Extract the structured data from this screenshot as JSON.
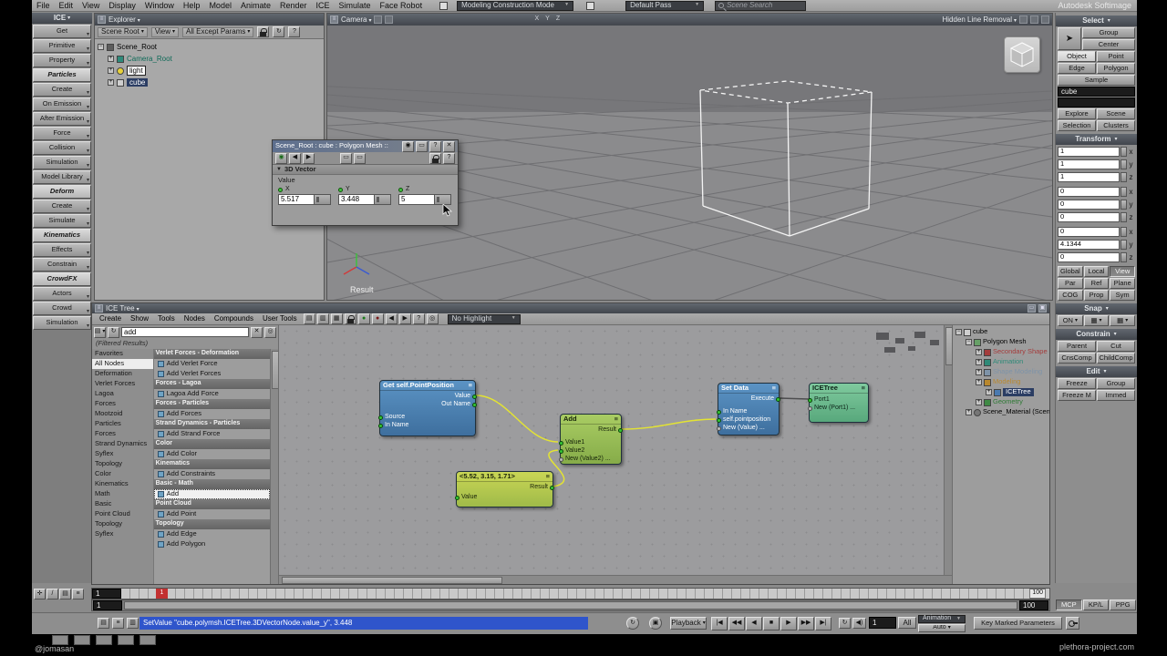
{
  "app": {
    "title": "Autodesk Softimage"
  },
  "footer": {
    "left": "@jomasan",
    "right": "plethora-project.com"
  },
  "icons": {
    "menu": "≡",
    "dropdown": "▾",
    "close": "✕",
    "help": "?",
    "refresh": "↻",
    "left": "◀",
    "right": "▶",
    "grid": "▦",
    "box": "▭",
    "circle": "◉",
    "record": "●",
    "loop": "↻",
    "speaker": "◀)",
    "plus": "+",
    "minus": "−",
    "target": "◎",
    "pan": "✛",
    "pencil": "/",
    "list": "▤",
    "rows": "▥"
  },
  "menubar": {
    "menus": [
      "File",
      "Edit",
      "View",
      "Display",
      "Window",
      "Help",
      "Model",
      "Animate",
      "Render",
      "ICE",
      "Simulate",
      "Face Robot"
    ],
    "construction_mode": "Modeling Construction Mode",
    "pass": "Default Pass",
    "search_placeholder": "Scene Search"
  },
  "left_toolbar": {
    "title": "ICE",
    "buttons": [
      {
        "label": "Get"
      },
      {
        "label": "Primitive"
      },
      {
        "label": "Property"
      },
      {
        "label": "Particles",
        "header": true
      },
      {
        "label": "Create"
      },
      {
        "label": "On Emission"
      },
      {
        "label": "After Emission"
      },
      {
        "label": "Force"
      },
      {
        "label": "Collision"
      },
      {
        "label": "Simulation"
      },
      {
        "label": "Model Library"
      },
      {
        "label": "Deform",
        "header": true
      },
      {
        "label": "Create"
      },
      {
        "label": "Simulate"
      },
      {
        "label": "Kinematics",
        "header": true
      },
      {
        "label": "Effects"
      },
      {
        "label": "Constrain"
      },
      {
        "label": "CrowdFX",
        "header": true
      },
      {
        "label": "Actors"
      },
      {
        "label": "Crowd"
      },
      {
        "label": "Simulation"
      }
    ]
  },
  "explorer": {
    "title": "Explorer",
    "scope": "Scene Root",
    "view_menu": "View",
    "filter_menu": "All Except Params",
    "tree": [
      {
        "label": "Scene_Root",
        "depth": 0,
        "icon": "scene-root-icon",
        "expanded": true
      },
      {
        "label": "Camera_Root",
        "depth": 1,
        "icon": "camera-icon",
        "color": "#0e6a58"
      },
      {
        "label": "light",
        "depth": 1,
        "icon": "light-icon",
        "boxed": true
      },
      {
        "label": "cube",
        "depth": 1,
        "icon": "cube-icon",
        "selected": true
      }
    ]
  },
  "viewport": {
    "camera_menu": "Camera",
    "axis_toggles": [
      "X",
      "Y",
      "Z"
    ],
    "shading_mode": "Hidden Line Removal",
    "result_label": "Result"
  },
  "ppg": {
    "title": "Scene_Root : cube : Polygon Mesh ::",
    "section": "3D Vector",
    "value_label": "Value",
    "fields": [
      {
        "axis": "X",
        "value": "5.517"
      },
      {
        "axis": "Y",
        "value": "3.448"
      },
      {
        "axis": "Z",
        "value": "5"
      }
    ]
  },
  "mcp": {
    "select_header": "Select",
    "group_btn": "Group",
    "center_btn": "Center",
    "filter_rows": [
      [
        "Object",
        "Point"
      ],
      [
        "Edge",
        "Polygon"
      ]
    ],
    "sample_btn": "Sample",
    "selection_value": "cube",
    "explore_btn": "Explore",
    "scene_btn": "Scene",
    "selection_btn": "Selection",
    "clusters_btn": "Clusters",
    "transform_header": "Transform",
    "transform_fields": [
      {
        "value": "1",
        "axis": "x"
      },
      {
        "value": "1",
        "axis": "y"
      },
      {
        "value": "1",
        "axis": "z"
      },
      {
        "value": "0",
        "axis": "x"
      },
      {
        "value": "0",
        "axis": "y"
      },
      {
        "value": "0",
        "axis": "z"
      },
      {
        "value": "0",
        "axis": "x"
      },
      {
        "value": "4.1344",
        "axis": "y"
      },
      {
        "value": "0",
        "axis": "z"
      }
    ],
    "space_row": [
      "Global",
      "Local",
      "View"
    ],
    "ref_row": [
      "Par",
      "Ref",
      "Plane"
    ],
    "cog_row": [
      "COG",
      "Prop",
      "Sym"
    ],
    "snap_header": "Snap",
    "snap_on": "ON",
    "constrain_header": "Constrain",
    "constrain_rows": [
      [
        "Parent",
        "Cut"
      ],
      [
        "CnsComp",
        "ChildComp"
      ]
    ],
    "edit_header": "Edit",
    "edit_rows": [
      [
        "Freeze",
        "Group"
      ],
      [
        "Freeze M",
        "Immed"
      ]
    ],
    "bottom_tabs": [
      "MCP",
      "KP/L",
      "PPG"
    ]
  },
  "ice_tree": {
    "title": "ICE Tree",
    "menus": [
      "Create",
      "Show",
      "Tools",
      "Nodes",
      "Compounds",
      "User Tools"
    ],
    "highlight_mode": "No Highlight",
    "search_value": "add",
    "filtered_label": "(Filtered Results)",
    "categories": [
      "Favorites",
      "All Nodes",
      "Deformation",
      "Verlet Forces",
      "Lagoa",
      "Forces",
      "Mootzoid",
      "Particles",
      "Forces",
      "Strand Dynamics",
      "Syflex",
      "Topology",
      "Color",
      "Kinematics",
      "Math",
      "Basic",
      "Point Cloud",
      "Topology",
      "Syflex"
    ],
    "selected_category": "All Nodes",
    "results": [
      {
        "type": "header",
        "label": "Verlet Forces - Deformation"
      },
      {
        "type": "item",
        "label": "Add Verlet Force"
      },
      {
        "type": "item",
        "label": "Add Verlet Forces"
      },
      {
        "type": "header",
        "label": "Forces - Lagoa"
      },
      {
        "type": "item",
        "label": "Lagoa Add Force"
      },
      {
        "type": "header",
        "label": "Forces - Particles"
      },
      {
        "type": "item",
        "label": "Add Forces"
      },
      {
        "type": "header",
        "label": "Strand Dynamics - Particles"
      },
      {
        "type": "item",
        "label": "Add Strand Force"
      },
      {
        "type": "header",
        "label": "Color"
      },
      {
        "type": "item",
        "label": "Add Color"
      },
      {
        "type": "header",
        "label": "Kinematics"
      },
      {
        "type": "item",
        "label": "Add Constraints"
      },
      {
        "type": "header",
        "label": "Basic - Math"
      },
      {
        "type": "item",
        "label": "Add",
        "selected": true
      },
      {
        "type": "header",
        "label": "Point Cloud"
      },
      {
        "type": "item",
        "label": "Add Point"
      },
      {
        "type": "header",
        "label": "Topology"
      },
      {
        "type": "item",
        "label": "Add Edge"
      },
      {
        "type": "item",
        "label": "Add Polygon"
      }
    ],
    "nodes": {
      "get": {
        "title": "Get self.PointPosition",
        "outputs": [
          "Value",
          "Out Name"
        ],
        "inputs": [
          "Source",
          "In Name"
        ]
      },
      "add": {
        "title": "Add",
        "outputs": [
          "Result"
        ],
        "inputs": [
          "Value1",
          "Value2",
          "New (Value2) ..."
        ]
      },
      "vector": {
        "title": "<5.52, 3.15, 1.71>",
        "outputs": [
          "Result"
        ],
        "inputs": [
          "Value"
        ]
      },
      "setdata": {
        "title": "Set Data",
        "outputs": [
          "Execute"
        ],
        "inputs": [
          "In Name",
          "self.pointposition",
          "New (Value) ..."
        ]
      },
      "icetree": {
        "title": "ICETree",
        "outputs": [],
        "inputs": [
          "Port1",
          "New (Port1) ..."
        ]
      }
    },
    "tree": [
      {
        "label": "cube",
        "depth": 0,
        "icon": "cube-icon",
        "expanded": true
      },
      {
        "label": "Polygon Mesh",
        "depth": 1,
        "icon": "mesh-icon",
        "expanded": true
      },
      {
        "label": "Secondary Shape M...",
        "depth": 2,
        "icon": "region-icon",
        "color": "#a43c3c"
      },
      {
        "label": "Animation",
        "depth": 2,
        "icon": "region-icon",
        "color": "#2f8a78"
      },
      {
        "label": "Shape Modeling",
        "depth": 2,
        "icon": "region-icon",
        "color": "#7e93a8"
      },
      {
        "label": "Modeling",
        "depth": 2,
        "icon": "region-icon",
        "color": "#b9882e"
      },
      {
        "label": "ICETree",
        "depth": 3,
        "icon": "icetree-icon",
        "selected": true
      },
      {
        "label": "Geometry",
        "depth": 2,
        "icon": "geometry-icon",
        "color": "#2f7a35"
      },
      {
        "label": "Scene_Material (Scen...",
        "depth": 1,
        "icon": "material-icon",
        "expanded": false
      }
    ]
  },
  "timeline": {
    "start": "1",
    "end": "100",
    "current": "1",
    "range_start": "1",
    "range_end": "100"
  },
  "playback": {
    "script_line": "SetValue \"cube.polymsh.ICETree.3DVectorNode.value_y\", 3.448",
    "playback_btn": "Playback",
    "transport": [
      "|◀",
      "◀◀",
      "◀",
      "■",
      "▶",
      "▶▶",
      "▶|"
    ],
    "frame_value": "1",
    "all_btn": "All",
    "animation_menu": "Animation",
    "auto_label": "Auto",
    "key_marked_btn": "Key Marked Parameters"
  }
}
